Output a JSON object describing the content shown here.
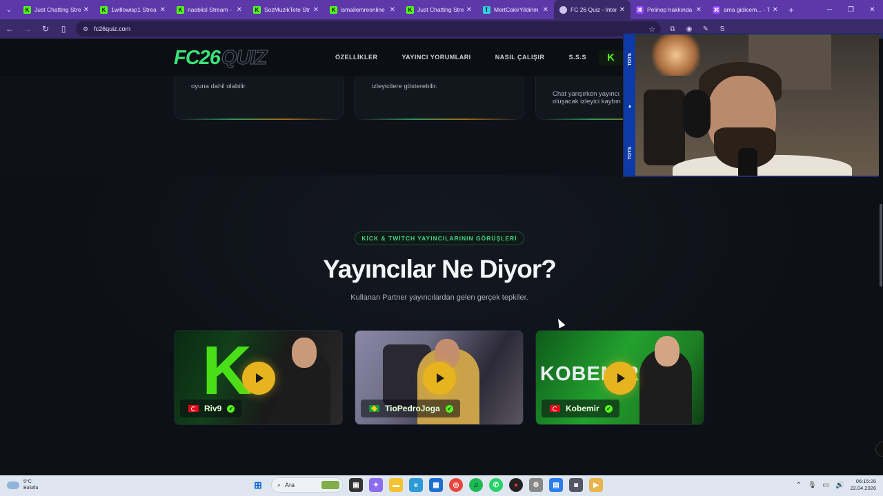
{
  "browser": {
    "tabs": [
      {
        "label": "Just Chatting Stre",
        "icon": "kick",
        "active": false
      },
      {
        "label": "1willowisp1 Strea",
        "icon": "kick",
        "active": false
      },
      {
        "label": "naeblisl Stream -",
        "icon": "kick",
        "active": false
      },
      {
        "label": "SozMuzikTete Str",
        "icon": "kick",
        "active": false
      },
      {
        "label": "ismailemreonline",
        "icon": "kick",
        "active": false
      },
      {
        "label": "Just Chatting Stre",
        "icon": "kick",
        "active": false
      },
      {
        "label": "MertCakirYildirim",
        "icon": "tt",
        "active": false
      },
      {
        "label": "FC 26 Quiz - Inter",
        "icon": "globe",
        "active": true
      },
      {
        "label": "Pelinop hakkında",
        "icon": "twitch",
        "active": false
      },
      {
        "label": "ama gidicem... - Tw",
        "icon": "twitch",
        "active": false
      }
    ],
    "url": "fc26quiz.com"
  },
  "site": {
    "logo_fc": "FC26",
    "logo_quiz": "QUIZ",
    "nav": [
      "ÖZELLİKLER",
      "YAYINCI YORUMLARI",
      "NASIL ÇALIŞIR",
      "S.S.S"
    ],
    "kick_badge": "K",
    "feature_snippets": [
      "oyuna dahil olabilir.",
      "izleyicilere gösterebilir.",
      "Chat yarışırken yayıncı\noluşacak izleyici kaybın"
    ],
    "section": {
      "pill": "KİCK & TWİTCH YAYINCILARININ GÖRÜŞLERİ",
      "title": "Yayıncılar Ne Diyor?",
      "subtitle": "Kullanan Partner yayıncılardan gelen gerçek tepkiler."
    },
    "videos": [
      {
        "name": "Riv9",
        "flag": "tr"
      },
      {
        "name": "TioPedroJoga",
        "flag": "br"
      },
      {
        "name": "Kobemir",
        "flag": "tr",
        "banner": "KOBEMIR"
      }
    ]
  },
  "webcam": {
    "strip_labels": [
      "TOTS",
      "TOTS"
    ]
  },
  "taskbar": {
    "weather_temp": "5°C",
    "weather_desc": "Bulutlu",
    "search_placeholder": "Ara",
    "time": "06:15:26",
    "date": "22.04.2026"
  }
}
